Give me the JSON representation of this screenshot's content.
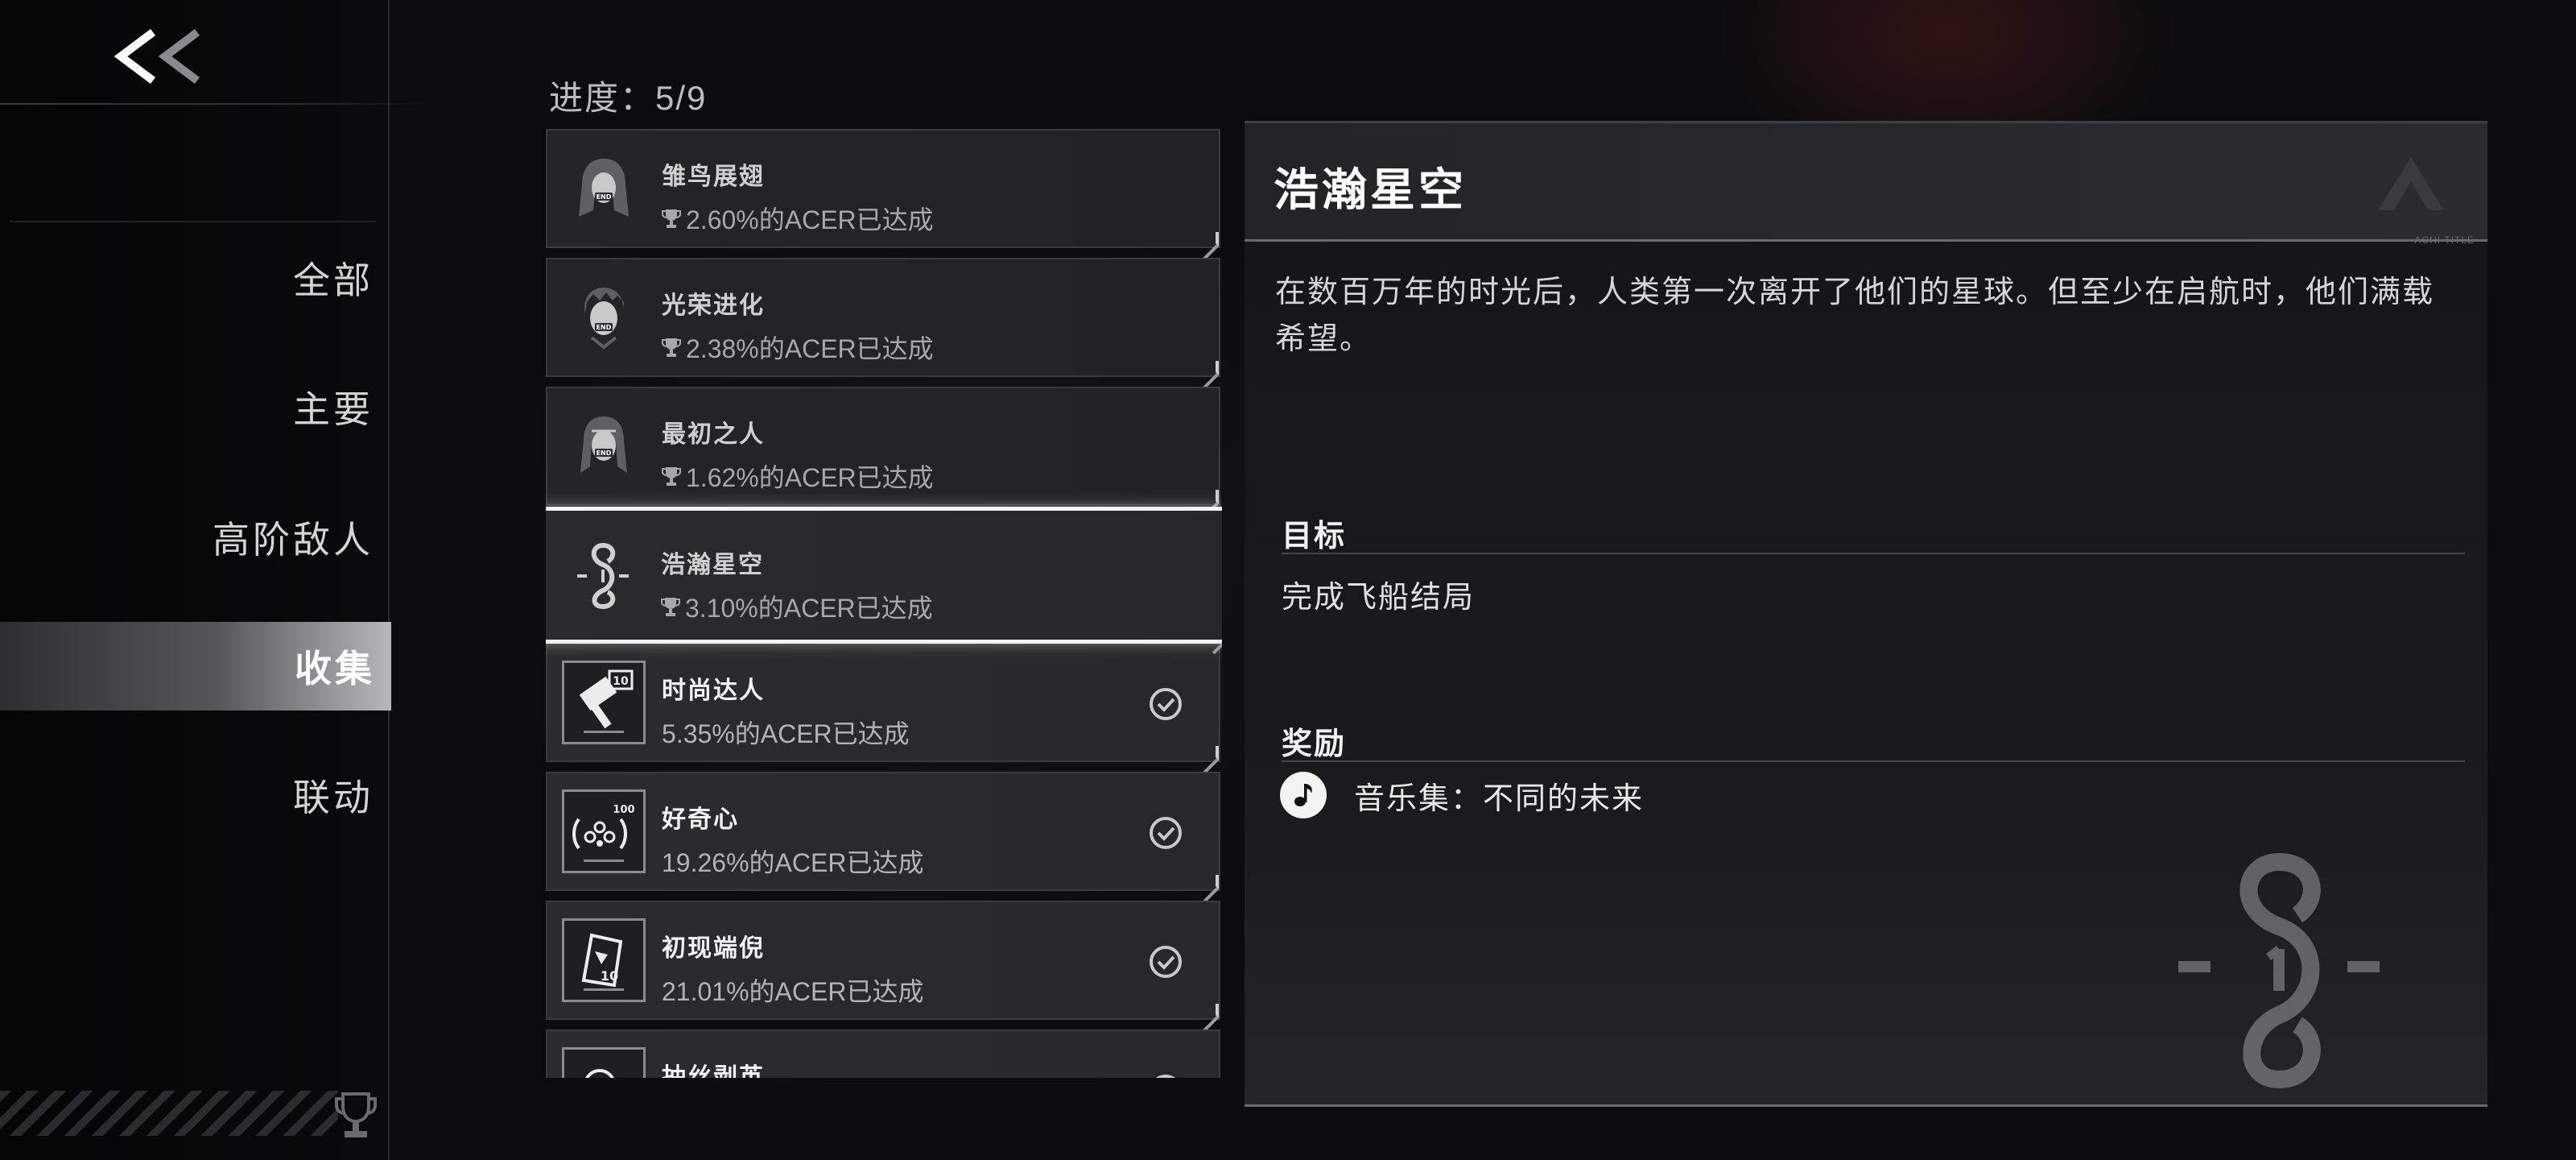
{
  "colors": {
    "background": "#0b0c0e",
    "panel": "#1a1b1e",
    "active_nav": "#b6b7b9",
    "selected_border": "#f2f2f2"
  },
  "header": {
    "back_icon": "double-chevron-left-icon"
  },
  "sidebar": {
    "items": [
      {
        "label": "全部",
        "active": false
      },
      {
        "label": "主要",
        "active": false
      },
      {
        "label": "高阶敌人",
        "active": false
      },
      {
        "label": "收集",
        "active": true
      },
      {
        "label": "联动",
        "active": false
      }
    ],
    "footer_icon": "trophy-icon"
  },
  "progress": {
    "text": "进度：5/9"
  },
  "achievements": [
    {
      "title": "雏鸟展翅",
      "rate": "2.60%的ACER已达成",
      "unlocked": false,
      "icon": "end-girl-icon"
    },
    {
      "title": "光荣进化",
      "rate": "2.38%的ACER已达成",
      "unlocked": false,
      "icon": "end-boy-icon"
    },
    {
      "title": "最初之人",
      "rate": "1.62%的ACER已达成",
      "unlocked": false,
      "icon": "end-girl-braids-icon"
    },
    {
      "title": "浩瀚星空",
      "rate": "3.10%的ACER已达成",
      "unlocked": false,
      "selected": true,
      "icon": "spaceship-emblem-icon"
    },
    {
      "title": "时尚达人",
      "rate": "5.35%的ACER已达成",
      "unlocked": true,
      "icon": "hammer-10-icon"
    },
    {
      "title": "好奇心",
      "rate": "19.26%的ACER已达成",
      "unlocked": true,
      "icon": "curiosity-100-icon"
    },
    {
      "title": "初现端倪",
      "rate": "21.01%的ACER已达成",
      "unlocked": true,
      "icon": "document-10-icon"
    },
    {
      "title": "抽丝剥茧",
      "rate": "",
      "unlocked": true,
      "icon": "magnifier-icon"
    }
  ],
  "detail": {
    "title": "浩瀚星空",
    "header_tag": "ACHI TITLE",
    "description": "在数百万年的时光后，人类第一次离开了他们的星球。但至少在启航时，他们满载希望。",
    "objective_label": "目标",
    "objective_text": "完成飞船结局",
    "reward_label": "奖励",
    "reward_text": "音乐集：不同的未来",
    "reward_icon": "music-note-icon"
  }
}
